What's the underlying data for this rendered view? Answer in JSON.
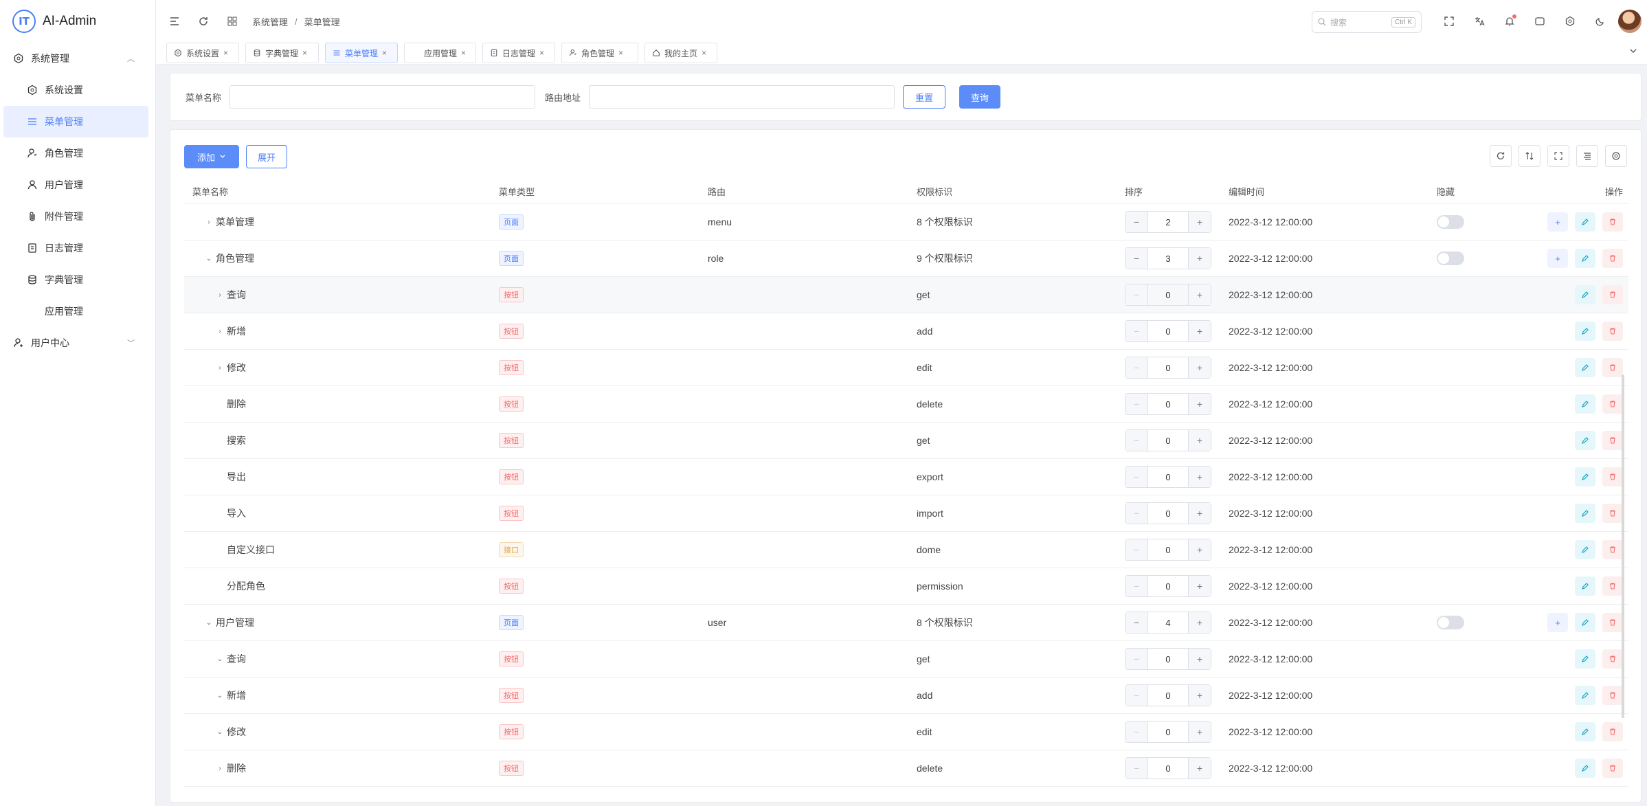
{
  "app": {
    "logo_mark": "IT",
    "title": "AI-Admin"
  },
  "sidebar": {
    "items": [
      {
        "label": "系统管理",
        "icon": "hexagon-gear-icon",
        "level": 1,
        "arrow": "︿"
      },
      {
        "label": "系统设置",
        "icon": "settings-icon",
        "level": 2
      },
      {
        "label": "菜单管理",
        "icon": "menu-icon",
        "level": 2,
        "active": true
      },
      {
        "label": "角色管理",
        "icon": "role-icon",
        "level": 2
      },
      {
        "label": "用户管理",
        "icon": "user-icon",
        "level": 2
      },
      {
        "label": "附件管理",
        "icon": "attachment-icon",
        "level": 2
      },
      {
        "label": "日志管理",
        "icon": "log-icon",
        "level": 2
      },
      {
        "label": "字典管理",
        "icon": "database-icon",
        "level": 2
      },
      {
        "label": "应用管理",
        "icon": "",
        "level": 2
      },
      {
        "label": "用户中心",
        "icon": "user-center-icon",
        "level": 1,
        "arrow": "﹀"
      }
    ]
  },
  "header": {
    "breadcrumb": [
      "系统管理",
      "菜单管理"
    ],
    "breadcrumb_sep": "/",
    "search_placeholder": "搜索",
    "search_shortcut": "Ctrl K"
  },
  "tabs": [
    {
      "label": "系统设置",
      "icon": "settings-icon"
    },
    {
      "label": "字典管理",
      "icon": "database-icon"
    },
    {
      "label": "菜单管理",
      "icon": "menu-icon",
      "active": true
    },
    {
      "label": "应用管理",
      "icon": ""
    },
    {
      "label": "日志管理",
      "icon": "log-icon"
    },
    {
      "label": "角色管理",
      "icon": "role-icon"
    },
    {
      "label": "我的主页",
      "icon": "home-icon"
    }
  ],
  "filter": {
    "name_label": "菜单名称",
    "name_value": "",
    "route_label": "路由地址",
    "route_value": "",
    "reset_label": "重置",
    "query_label": "查询"
  },
  "toolbar": {
    "add_label": "添加",
    "expand_label": "展开"
  },
  "table": {
    "columns": [
      "菜单名称",
      "菜单类型",
      "路由",
      "权限标识",
      "排序",
      "编辑时间",
      "隐藏",
      "操作"
    ],
    "rows": [
      {
        "name": "菜单管理",
        "indent": 1,
        "arrow": "›",
        "type": "页面",
        "kind": "page",
        "route": "menu",
        "perm": "8 个权限标识",
        "sort": "2",
        "time": "2022-3-12 12:00:00",
        "hide": true,
        "add": true
      },
      {
        "name": "角色管理",
        "indent": 1,
        "arrow": "⌄",
        "type": "页面",
        "kind": "page",
        "route": "role",
        "perm": "9 个权限标识",
        "sort": "3",
        "time": "2022-3-12 12:00:00",
        "hide": true,
        "add": true
      },
      {
        "name": "查询",
        "indent": 2,
        "arrow": "›",
        "type": "按钮",
        "kind": "button",
        "route": "",
        "perm": "get",
        "sort": "0",
        "time": "2022-3-12 12:00:00",
        "hl": true
      },
      {
        "name": "新增",
        "indent": 2,
        "arrow": "›",
        "type": "按钮",
        "kind": "button",
        "route": "",
        "perm": "add",
        "sort": "0",
        "time": "2022-3-12 12:00:00"
      },
      {
        "name": "修改",
        "indent": 2,
        "arrow": "›",
        "type": "按钮",
        "kind": "button",
        "route": "",
        "perm": "edit",
        "sort": "0",
        "time": "2022-3-12 12:00:00"
      },
      {
        "name": "删除",
        "indent": 2,
        "arrow": "",
        "type": "按钮",
        "kind": "button",
        "route": "",
        "perm": "delete",
        "sort": "0",
        "time": "2022-3-12 12:00:00"
      },
      {
        "name": "搜索",
        "indent": 2,
        "arrow": "",
        "type": "按钮",
        "kind": "button",
        "route": "",
        "perm": "get",
        "sort": "0",
        "time": "2022-3-12 12:00:00"
      },
      {
        "name": "导出",
        "indent": 2,
        "arrow": "",
        "type": "按钮",
        "kind": "button",
        "route": "",
        "perm": "export",
        "sort": "0",
        "time": "2022-3-12 12:00:00"
      },
      {
        "name": "导入",
        "indent": 2,
        "arrow": "",
        "type": "按钮",
        "kind": "button",
        "route": "",
        "perm": "import",
        "sort": "0",
        "time": "2022-3-12 12:00:00"
      },
      {
        "name": "自定义接口",
        "indent": 2,
        "arrow": "",
        "type": "接口",
        "kind": "api",
        "route": "",
        "perm": "dome",
        "sort": "0",
        "time": "2022-3-12 12:00:00"
      },
      {
        "name": "分配角色",
        "indent": 2,
        "arrow": "",
        "type": "按钮",
        "kind": "button",
        "route": "",
        "perm": "permission",
        "sort": "0",
        "time": "2022-3-12 12:00:00"
      },
      {
        "name": "用户管理",
        "indent": 1,
        "arrow": "⌄",
        "type": "页面",
        "kind": "page",
        "route": "user",
        "perm": "8 个权限标识",
        "sort": "4",
        "time": "2022-3-12 12:00:00",
        "hide": true,
        "add": true
      },
      {
        "name": "查询",
        "indent": 2,
        "arrow": "⌄",
        "type": "按钮",
        "kind": "button",
        "route": "",
        "perm": "get",
        "sort": "0",
        "time": "2022-3-12 12:00:00"
      },
      {
        "name": "新增",
        "indent": 2,
        "arrow": "⌄",
        "type": "按钮",
        "kind": "button",
        "route": "",
        "perm": "add",
        "sort": "0",
        "time": "2022-3-12 12:00:00"
      },
      {
        "name": "修改",
        "indent": 2,
        "arrow": "⌄",
        "type": "按钮",
        "kind": "button",
        "route": "",
        "perm": "edit",
        "sort": "0",
        "time": "2022-3-12 12:00:00"
      },
      {
        "name": "删除",
        "indent": 2,
        "arrow": "›",
        "type": "按钮",
        "kind": "button",
        "route": "",
        "perm": "delete",
        "sort": "0",
        "time": "2022-3-12 12:00:00"
      }
    ]
  },
  "colors": {
    "primary": "#4a7ef7",
    "page_badge": "#4a7ef7",
    "button_badge": "#f56c6c",
    "api_badge": "#e6a23c"
  }
}
